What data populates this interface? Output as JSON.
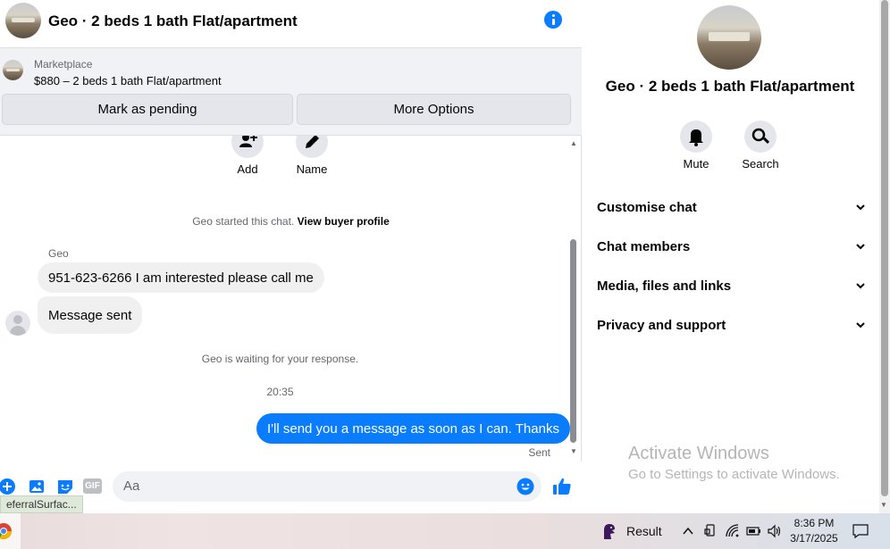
{
  "header": {
    "title": "Geo · 2 beds 1 bath Flat/apartment"
  },
  "marketplace": {
    "label": "Marketplace",
    "listing": "$880 – 2 beds 1 bath Flat/apartment",
    "mark_pending": "Mark as pending",
    "more_options": "More Options"
  },
  "quick_actions": {
    "add": "Add",
    "name": "Name"
  },
  "messages": {
    "started_prefix": "Geo started this chat.",
    "view_profile": "View buyer profile",
    "sender": "Geo",
    "incoming_1": "951-623-6266 I am interested please call me",
    "incoming_2": "Message sent",
    "waiting": "Geo is waiting for your response.",
    "time": "20:35",
    "outgoing_1": "I'll send you a message as soon as I can. Thanks",
    "status": "Sent"
  },
  "composer": {
    "placeholder": "Aa",
    "gif": "GIF"
  },
  "status_tooltip": "eferralSurfac...",
  "info_pane": {
    "title": "Geo · 2 beds 1 bath Flat/apartment",
    "mute": "Mute",
    "search": "Search",
    "sections": [
      "Customise chat",
      "Chat members",
      "Media, files and links",
      "Privacy and support"
    ]
  },
  "watermark": {
    "title": "Activate Windows",
    "subtitle": "Go to Settings to activate Windows."
  },
  "taskbar": {
    "result": "Result",
    "time": "8:36 PM",
    "date": "3/17/2025"
  },
  "colors": {
    "accent": "#0a7cff",
    "bubble_in": "#f0f0f0"
  }
}
